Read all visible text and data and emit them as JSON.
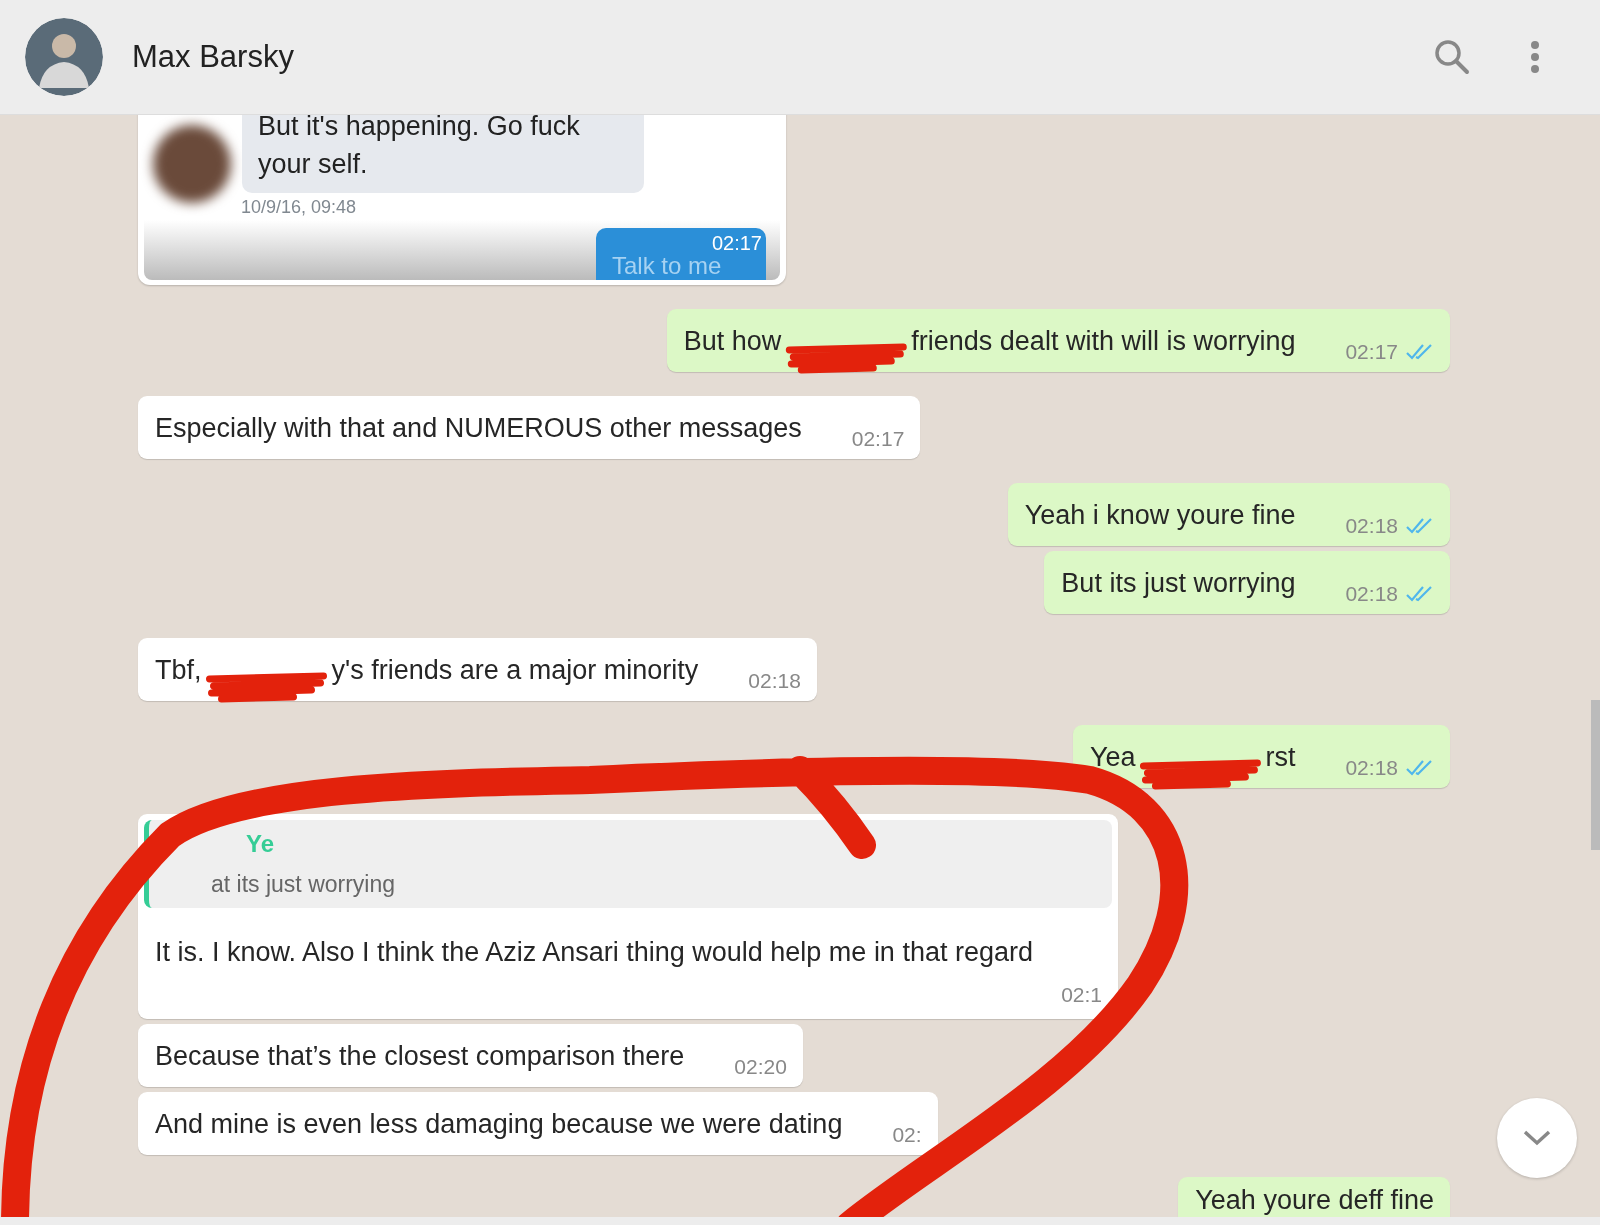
{
  "header": {
    "contact_name": "Max Barsky"
  },
  "messages": [
    {
      "kind": "card",
      "text": "But it's happening. Go fuck your self.",
      "date": "10/9/16, 09:48",
      "button": "Talk to me",
      "time": "02:17"
    },
    {
      "kind": "out",
      "parts": [
        "But how",
        "friends dealt with will is worrying"
      ],
      "time": "02:17",
      "read": true
    },
    {
      "kind": "in",
      "parts": [
        "Especially with that and NUMEROUS other messages"
      ],
      "time": "02:17"
    },
    {
      "kind": "out",
      "parts": [
        "Yeah i know youre fine"
      ],
      "time": "02:18",
      "read": true
    },
    {
      "kind": "out",
      "parts": [
        "But its just worrying"
      ],
      "time": "02:18",
      "read": true
    },
    {
      "kind": "in",
      "parts": [
        "Tbf,",
        "y's friends are a major minority"
      ],
      "time": "02:18"
    },
    {
      "kind": "out",
      "parts": [
        "Yea",
        "rst"
      ],
      "time": "02:18",
      "read": true
    },
    {
      "kind": "reply",
      "quote_author": "Ye",
      "quote_text": "at its just worrying",
      "parts": [
        "It is. I know. Also I think the Aziz Ansari thing would help me in that regard"
      ],
      "time": "02:1"
    },
    {
      "kind": "in",
      "parts": [
        "Because that’s the closest comparison there"
      ],
      "time": "02:20"
    },
    {
      "kind": "in",
      "parts": [
        "And mine is even less damaging because we were dating"
      ],
      "time": "02:"
    },
    {
      "kind": "out",
      "parts": [
        "Yeah youre deff fine"
      ]
    }
  ]
}
